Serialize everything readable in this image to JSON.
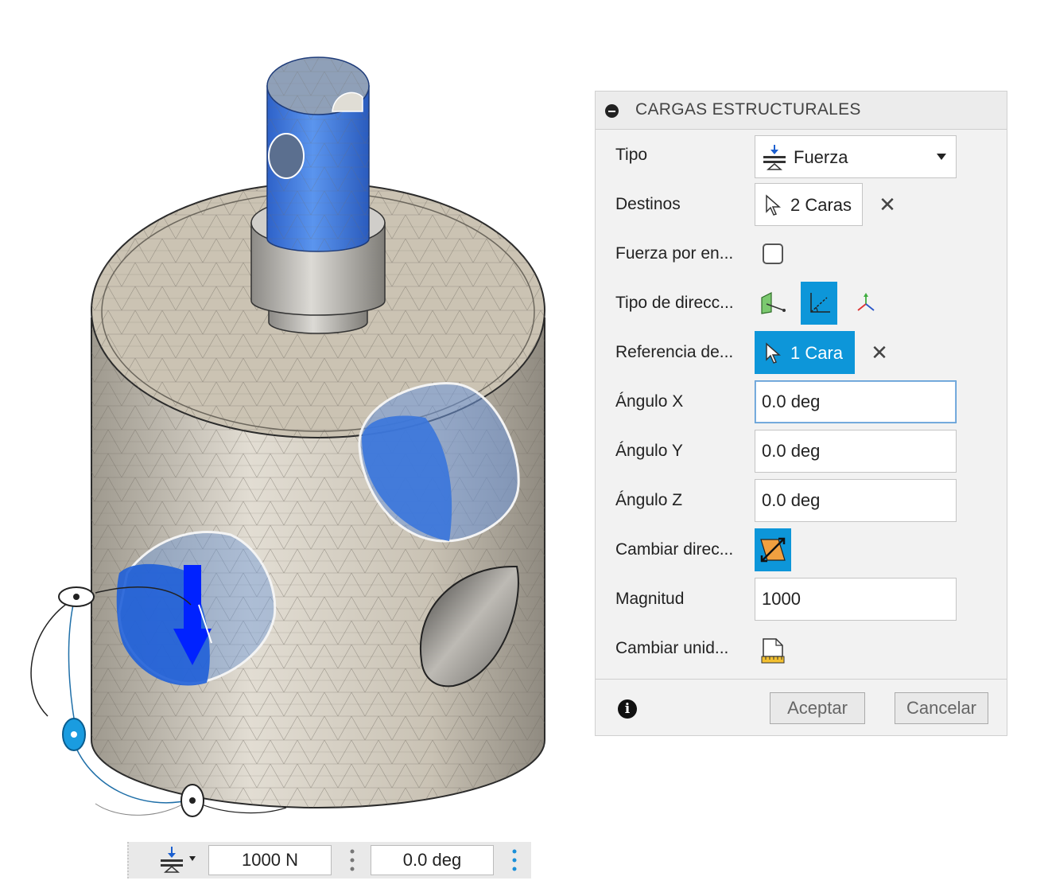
{
  "dialog": {
    "title": "CARGAS ESTRUCTURALES",
    "rows": {
      "tipo": {
        "label": "Tipo",
        "value": "Fuerza"
      },
      "destinos": {
        "label": "Destinos",
        "value": "2 Caras"
      },
      "fuerza_por_entidad": {
        "label": "Fuerza por en...",
        "checked": false
      },
      "tipo_direccion": {
        "label": "Tipo de direcc...",
        "options": [
          "plane-point-icon",
          "angle-icon",
          "axes-icon"
        ],
        "active_index": 1
      },
      "referencia": {
        "label": "Referencia de...",
        "value": "1 Cara"
      },
      "angulo_x": {
        "label": "Ángulo X",
        "value": "0.0 deg"
      },
      "angulo_y": {
        "label": "Ángulo Y",
        "value": "0.0 deg"
      },
      "angulo_z": {
        "label": "Ángulo Z",
        "value": "0.0 deg"
      },
      "cambiar_direccion": {
        "label": "Cambiar direc..."
      },
      "magnitud": {
        "label": "Magnitud",
        "value": "1000"
      },
      "cambiar_unidades": {
        "label": "Cambiar unid..."
      }
    },
    "footer": {
      "accept_label": "Aceptar",
      "cancel_label": "Cancelar"
    }
  },
  "mini_toolbar": {
    "force_value": "1000 N",
    "angle_value": "0.0 deg"
  },
  "colors": {
    "accent": "#0d96d9",
    "model_body": "#cfc8ba",
    "selected_face": "#3a76dc",
    "load_arrow": "#0022ff"
  }
}
